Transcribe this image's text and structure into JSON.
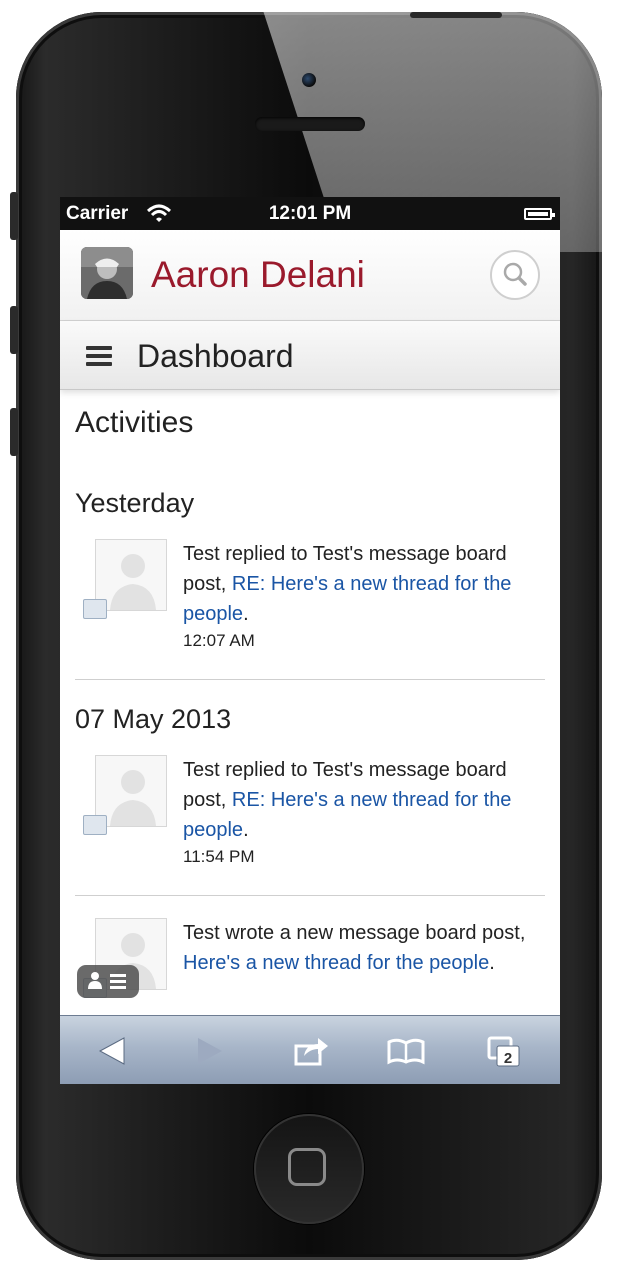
{
  "status": {
    "carrier": "Carrier",
    "time": "12:01 PM"
  },
  "header": {
    "user_name": "Aaron Delani"
  },
  "nav": {
    "title": "Dashboard"
  },
  "page": {
    "heading": "Activities"
  },
  "groups": [
    {
      "date": "Yesterday",
      "text_before": "Test replied to Test's message board post, ",
      "link": "RE: Here's a new thread for the people",
      "text_after": ".",
      "time": "12:07 AM"
    },
    {
      "date": "07 May 2013",
      "text_before": "Test replied to Test's message board post, ",
      "link": "RE: Here's a new thread for the people",
      "text_after": ".",
      "time": "11:54 PM"
    },
    {
      "date": "",
      "text_before": "Test wrote a new message board post, ",
      "link": "Here's a new thread for the people",
      "text_after": ".",
      "time": ""
    }
  ],
  "toolbar": {
    "tabs_count": "2"
  },
  "colors": {
    "accent": "#9a1a2c",
    "link": "#1a55a5",
    "toolbar": "#a8b6c9"
  },
  "icons": [
    "wifi-icon",
    "battery-icon",
    "search-icon",
    "menu-icon",
    "back-icon",
    "forward-icon",
    "share-icon",
    "bookmarks-icon",
    "tabs-icon"
  ]
}
